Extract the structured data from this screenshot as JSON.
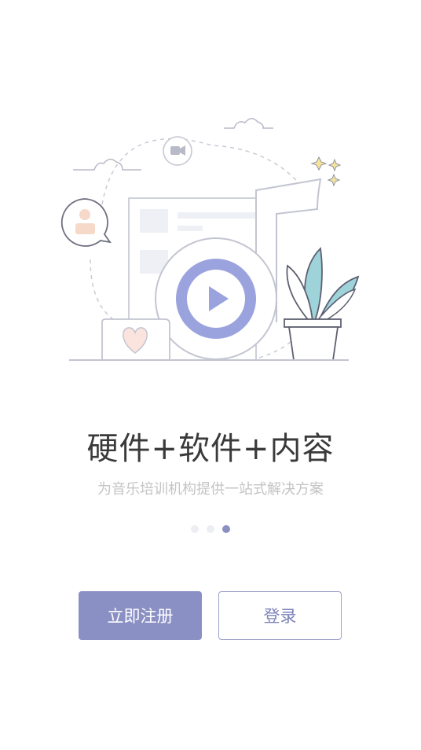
{
  "onboarding": {
    "headline": "硬件+软件+内容",
    "subtitle": "为音乐培训机构提供一站式解决方案",
    "page_indicator": {
      "total": 3,
      "active_index": 2
    }
  },
  "actions": {
    "register_label": "立即注册",
    "login_label": "登录"
  },
  "colors": {
    "accent": "#8b90c4",
    "play_circle": "#9aa3de",
    "plant": "#9fd3da",
    "headline": "#3a3a3a",
    "subtitle": "#c4c4c4"
  }
}
